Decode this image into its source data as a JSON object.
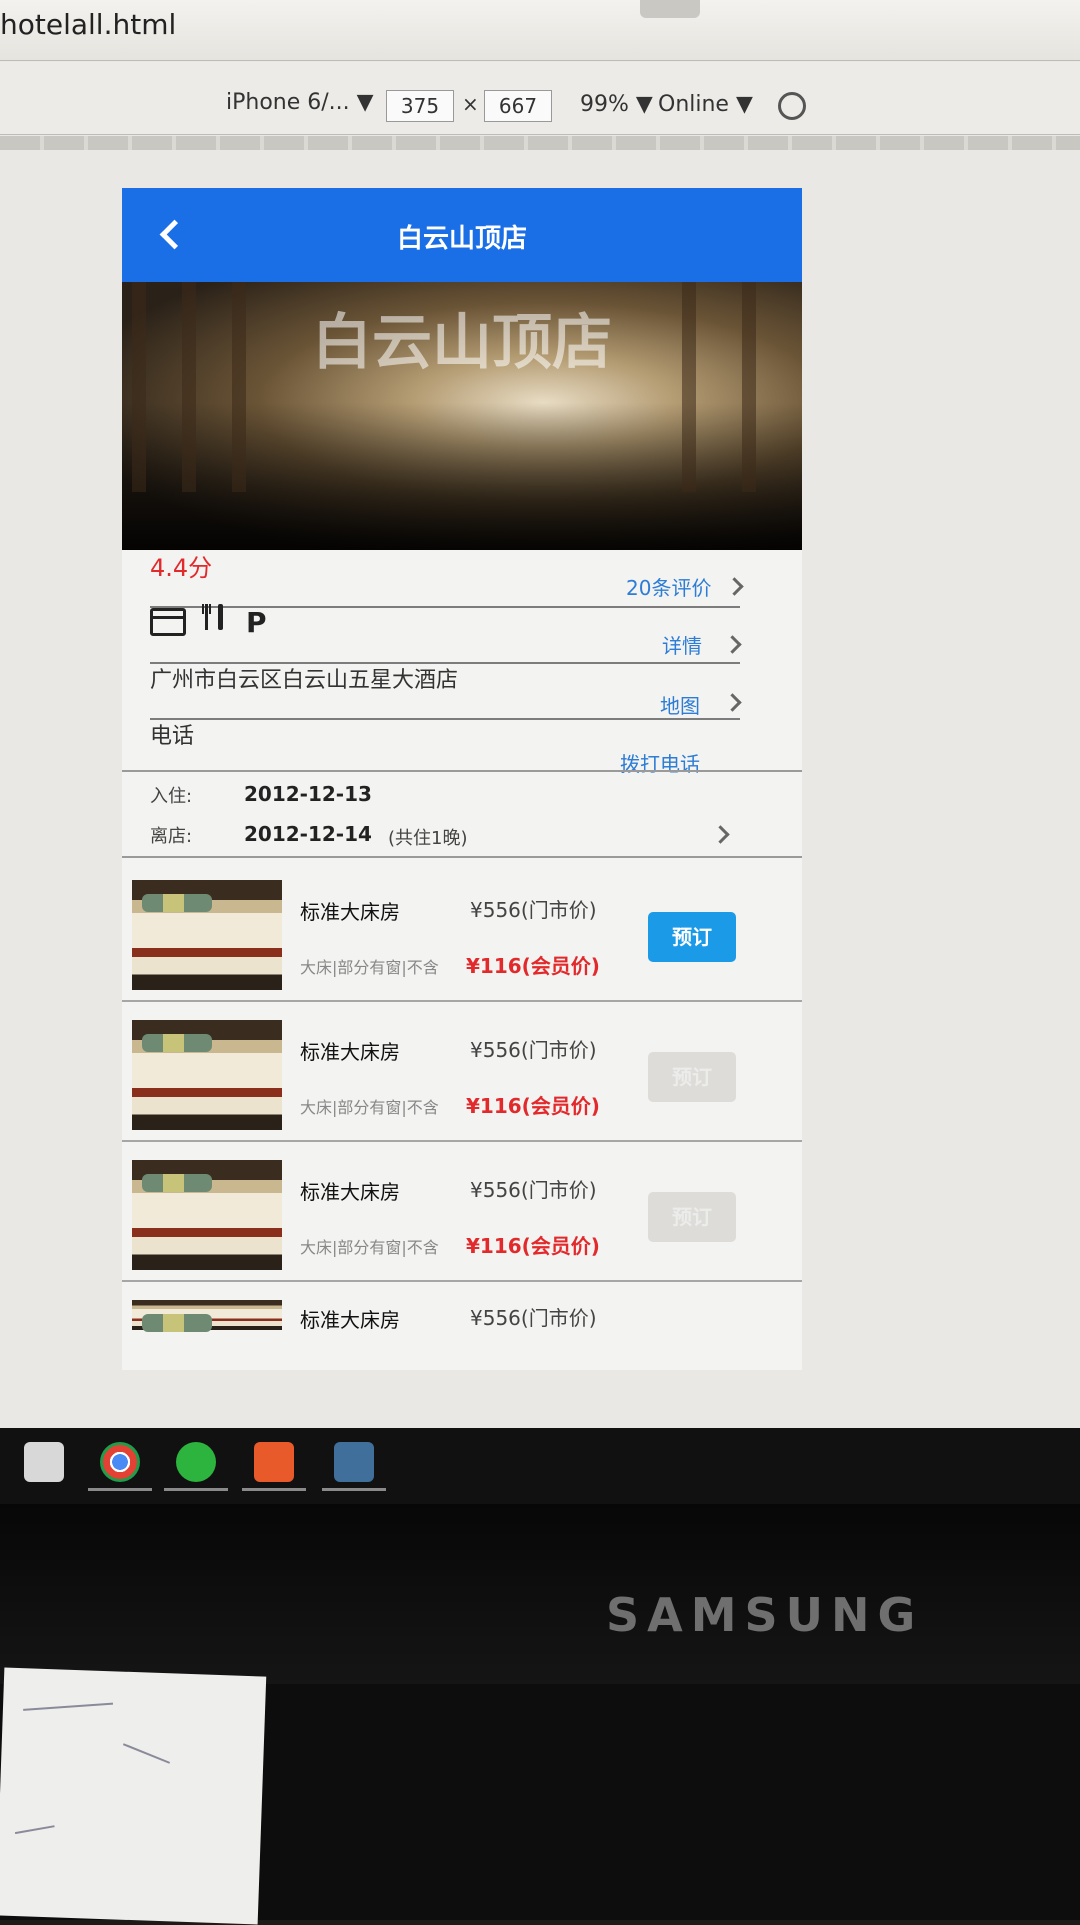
{
  "browser": {
    "tab_title": "hotelall.html",
    "device": "iPhone 6/... ▼",
    "width": "375",
    "times": "×",
    "height": "667",
    "zoom": "99% ▼",
    "network": "Online ▼"
  },
  "app": {
    "header_title": "白云山顶店",
    "hero_title": "白云山顶店",
    "rating": "4.4分",
    "reviews_link": "20条评价",
    "details_link": "详情",
    "address": "广州市白云区白云山五星大酒店",
    "map_link": "地图",
    "phone_label": "电话",
    "call_link": "拨打电话",
    "amenity_parking": "P",
    "checkin_label": "入住:",
    "checkin_date": "2012-12-13",
    "checkout_label": "离店:",
    "checkout_date": "2012-12-14",
    "nights": "(共住1晚)"
  },
  "rooms": [
    {
      "name": "标准大床房",
      "rack_price": "¥556(门市价)",
      "desc": "大床|部分有窗|不含",
      "member_price": "¥116(会员价)",
      "book": "预订"
    },
    {
      "name": "标准大床房",
      "rack_price": "¥556(门市价)",
      "desc": "大床|部分有窗|不含",
      "member_price": "¥116(会员价)",
      "book": "预订"
    },
    {
      "name": "标准大床房",
      "rack_price": "¥556(门市价)",
      "desc": "大床|部分有窗|不含",
      "member_price": "¥116(会员价)",
      "book": "预订"
    },
    {
      "name": "标准大床房",
      "rack_price": "¥556(门市价)"
    }
  ],
  "monitor": {
    "brand": "SAMSUNG"
  },
  "colors": {
    "header_blue": "#1a6ee6",
    "price_red": "#e2292b",
    "link_blue": "#2d7cd6",
    "book_blue": "#1b9ae8"
  },
  "icons": [
    "chevron-left-icon",
    "chevron-right-icon",
    "card-icon",
    "fork-knife-icon",
    "parking-icon",
    "rotate-icon",
    "calculator-icon",
    "chrome-icon",
    "wechat-icon",
    "hbuilder-icon",
    "sublime-icon"
  ]
}
